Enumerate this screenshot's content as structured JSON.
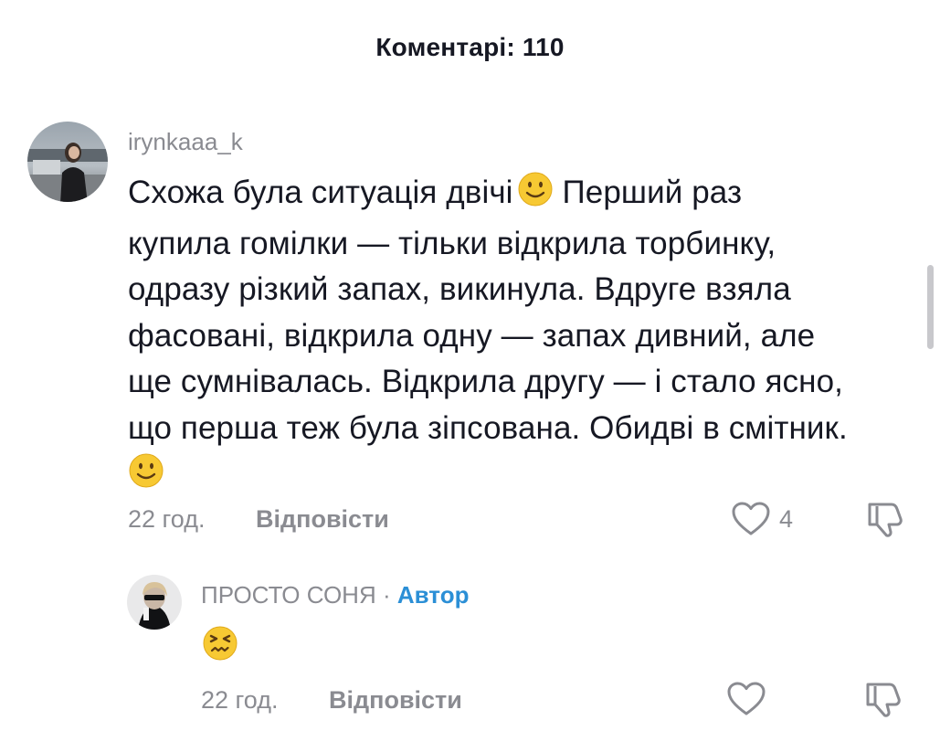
{
  "header": {
    "title": "Коментарі: 110"
  },
  "comments": [
    {
      "username": "irynkaaa_k",
      "text_lines": [
        "Схожа була ситуація двічі",
        "Перший раз",
        "купила гомілки — тільки відкрила торбинку,",
        "одразу різкий запах, викинула. Вдруге взяла",
        "фасовані, відкрила одну — запах дивний, але",
        "ще сумнівалась. Відкрила другу — і стало ясно,",
        "що перша теж була зіпсована. Обидві в смітник."
      ],
      "emojis": [
        "slightly-smiling-face",
        "slightly-smiling-face"
      ],
      "time": "22 год.",
      "reply_label": "Відповісти",
      "likes": "4"
    },
    {
      "username": "ПРОСТО СОНЯ",
      "separator": "·",
      "author_badge": "Автор",
      "emojis": [
        "confounded-face"
      ],
      "time": "22 год.",
      "reply_label": "Відповісти",
      "likes": ""
    }
  ],
  "icons": {
    "like": "heart-outline-icon",
    "dislike": "thumbs-down-icon"
  },
  "colors": {
    "text_primary": "#161823",
    "text_secondary": "#8a8b91",
    "author_badge": "#2b8fd6",
    "emoji_yellow": "#f7c933"
  }
}
